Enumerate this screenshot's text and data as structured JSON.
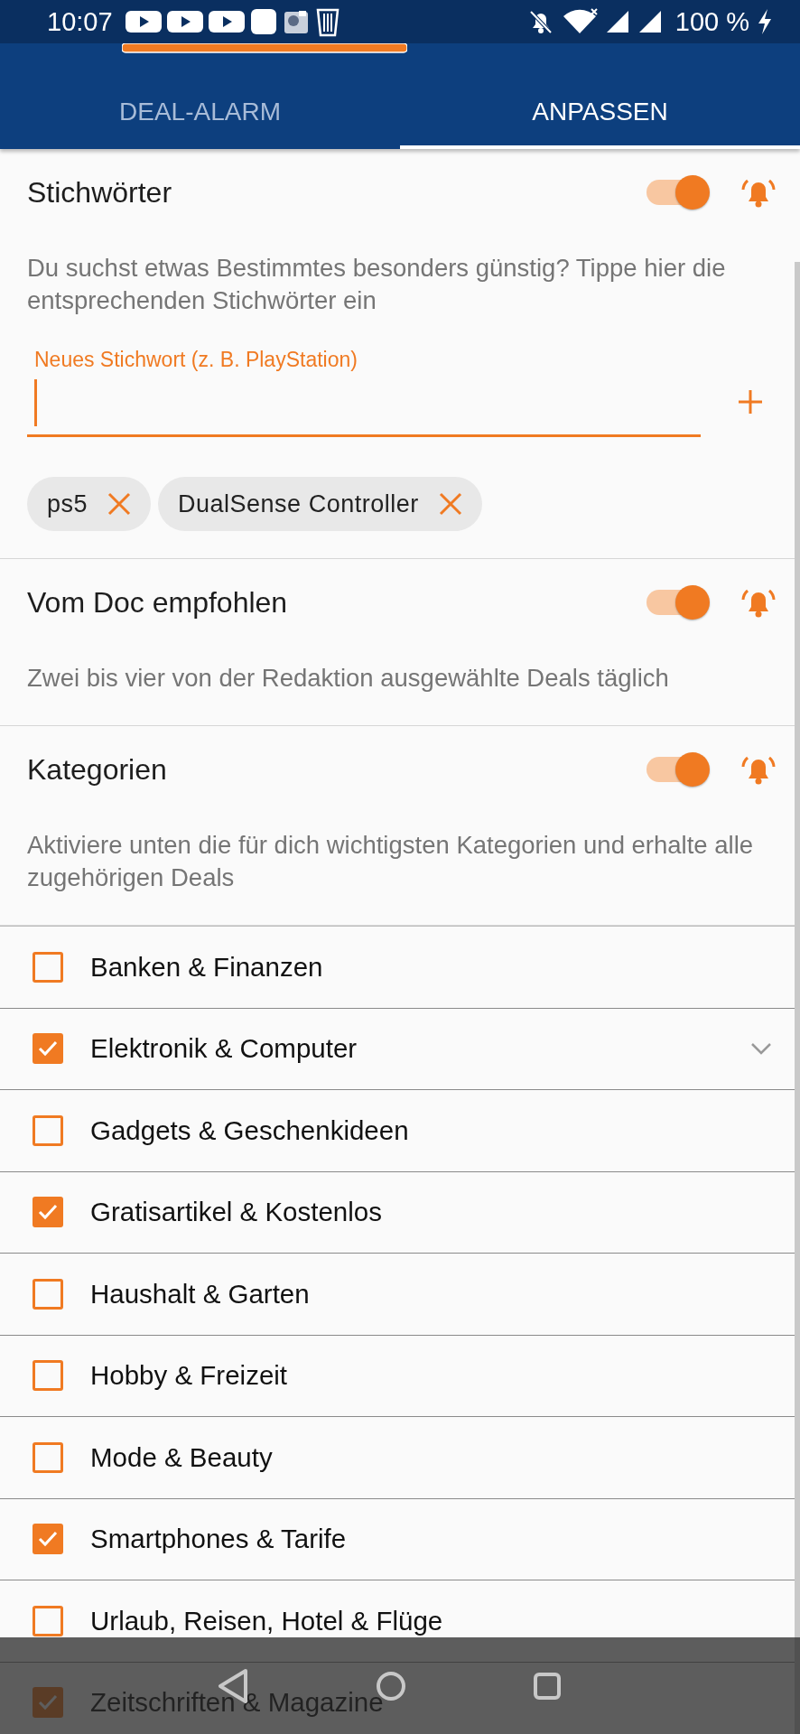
{
  "status_bar": {
    "time": "10:07",
    "battery": "100 %"
  },
  "tabs": [
    {
      "label": "DEAL-ALARM",
      "selected": false
    },
    {
      "label": "ANPASSEN",
      "selected": true
    }
  ],
  "sections": [
    {
      "title": "Stichwörter",
      "on": true,
      "description": "Du suchst etwas Bestimmtes besonders günstig? Tippe hier die entsprechenden Stichwörter ein",
      "keyword_field": {
        "label": "Neues Stichwort (z. B. PlayStation)"
      },
      "chips": [
        "ps5",
        "DualSense Controller"
      ]
    },
    {
      "title": "Vom Doc empfohlen",
      "on": true,
      "description": "Zwei bis vier von der Redaktion ausgewählte Deals täglich"
    },
    {
      "title": "Kategorien",
      "on": true,
      "description": "Aktiviere unten die für dich wichtigsten Kategorien und erhalte alle zugehörigen Deals"
    }
  ],
  "categories": [
    {
      "label": "Banken & Finanzen",
      "checked": false,
      "expandable": false
    },
    {
      "label": "Elektronik & Computer",
      "checked": true,
      "expandable": true
    },
    {
      "label": "Gadgets & Geschenkideen",
      "checked": false,
      "expandable": false
    },
    {
      "label": "Gratisartikel & Kostenlos",
      "checked": true,
      "expandable": false
    },
    {
      "label": "Haushalt & Garten",
      "checked": false,
      "expandable": false
    },
    {
      "label": "Hobby & Freizeit",
      "checked": false,
      "expandable": false
    },
    {
      "label": "Mode & Beauty",
      "checked": false,
      "expandable": false
    },
    {
      "label": "Smartphones & Tarife",
      "checked": true,
      "expandable": false
    },
    {
      "label": "Urlaub, Reisen, Hotel & Flüge",
      "checked": false,
      "expandable": false
    },
    {
      "label": "Zeitschriften & Magazine",
      "checked": true,
      "expandable": false
    }
  ]
}
